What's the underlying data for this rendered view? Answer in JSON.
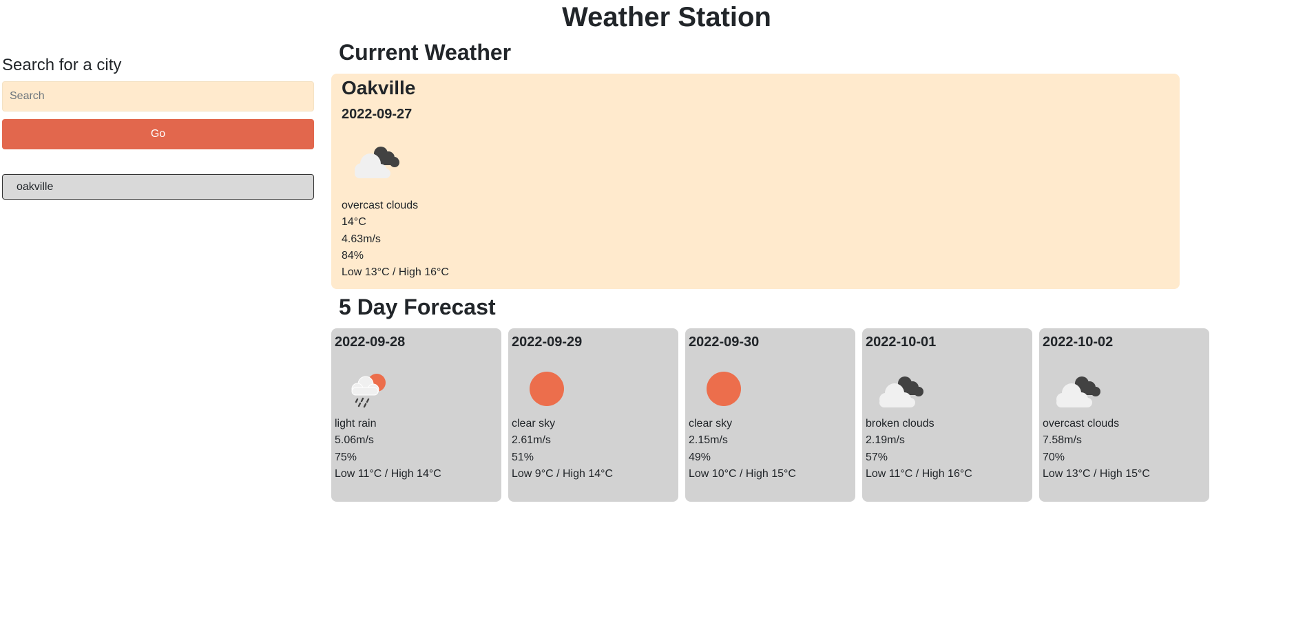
{
  "app": {
    "title": "Weather Station"
  },
  "sidebar": {
    "heading": "Search for a city",
    "search_placeholder": "Search",
    "search_value": "",
    "go_label": "Go",
    "history": [
      "oakville"
    ]
  },
  "current": {
    "heading": "Current Weather",
    "city": "Oakville",
    "date": "2022-09-27",
    "icon": "overcast-clouds-icon",
    "description": "overcast clouds",
    "temperature": "14°C",
    "wind": "4.63m/s",
    "humidity": "84%",
    "range": "Low 13°C / High 16°C"
  },
  "forecast": {
    "heading": "5 Day Forecast",
    "days": [
      {
        "date": "2022-09-28",
        "icon": "light-rain-icon",
        "description": "light rain",
        "wind": "5.06m/s",
        "humidity": "75%",
        "range": "Low 11°C / High 14°C"
      },
      {
        "date": "2022-09-29",
        "icon": "clear-sky-icon",
        "description": "clear sky",
        "wind": "2.61m/s",
        "humidity": "51%",
        "range": "Low 9°C / High 14°C"
      },
      {
        "date": "2022-09-30",
        "icon": "clear-sky-icon",
        "description": "clear sky",
        "wind": "2.15m/s",
        "humidity": "49%",
        "range": "Low 10°C / High 15°C"
      },
      {
        "date": "2022-10-01",
        "icon": "broken-clouds-icon",
        "description": "broken clouds",
        "wind": "2.19m/s",
        "humidity": "57%",
        "range": "Low 11°C / High 16°C"
      },
      {
        "date": "2022-10-02",
        "icon": "overcast-clouds-icon",
        "description": "overcast clouds",
        "wind": "7.58m/s",
        "humidity": "70%",
        "range": "Low 13°C / High 15°C"
      }
    ]
  },
  "colors": {
    "accent": "#e2674d",
    "current_card_bg": "#ffeacd",
    "forecast_card_bg": "#d2d2d2",
    "sun": "#ec6e4c",
    "cloud_dark": "#424242",
    "cloud_light": "#f0f0f0"
  }
}
